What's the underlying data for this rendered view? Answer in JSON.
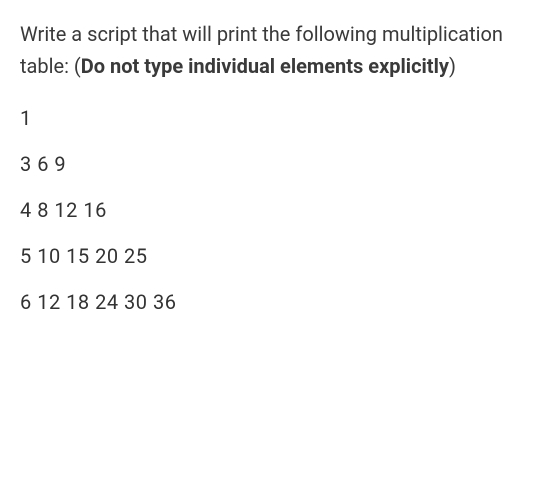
{
  "instruction": {
    "part1": "Write a script that will print the following multiplication table: (",
    "bold": "Do not type individual elements explicitly",
    "part2": ")"
  },
  "rows": [
    "1",
    "3  6  9",
    "4   8   12   16",
    "5   10  15  20  25",
    "6  12  18  24  30  36"
  ]
}
